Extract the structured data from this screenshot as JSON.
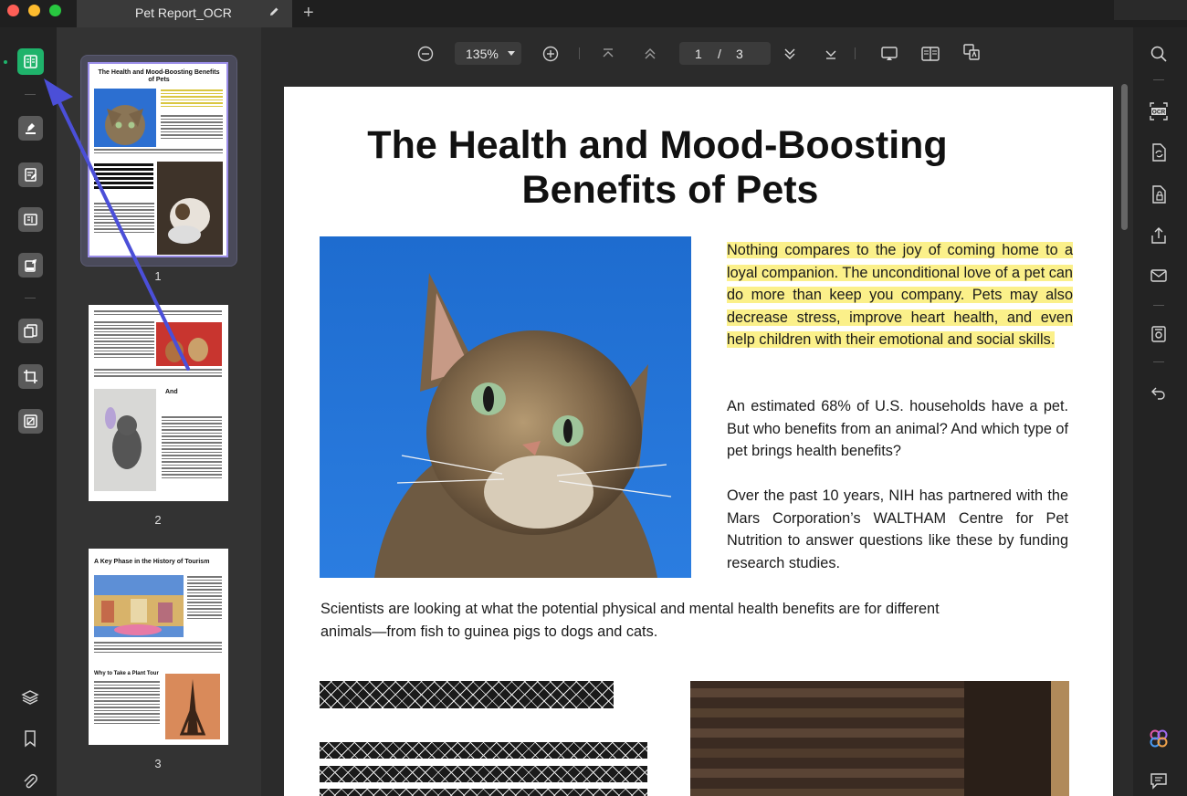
{
  "window": {
    "tab_title": "Pet Report_OCR",
    "edit_icon": "pencil-icon",
    "add_tab_label": "+"
  },
  "left_rail": {
    "items": [
      {
        "name": "reader-mode",
        "icon": "book-icon",
        "active": true
      },
      {
        "name": "comment",
        "icon": "highlighter-icon"
      },
      {
        "name": "edit-pdf",
        "icon": "edit-doc-icon"
      },
      {
        "name": "page-layout",
        "icon": "form-icon"
      },
      {
        "name": "sign",
        "icon": "signature-icon"
      },
      {
        "name": "organize",
        "icon": "pages-icon"
      },
      {
        "name": "crop",
        "icon": "crop-icon"
      },
      {
        "name": "protect",
        "icon": "compress-icon"
      }
    ],
    "bottom": [
      "layers-icon",
      "bookmark-icon",
      "attachment-icon"
    ]
  },
  "thumbnails": {
    "pages": [
      {
        "number": "1",
        "title": "The Health and Mood-Boosting Benefits of Pets"
      },
      {
        "number": "2",
        "title": "And"
      },
      {
        "number": "3",
        "title": "A Key Phase in the History of Tourism",
        "subhead": "Why to Take a Plant Tour"
      }
    ]
  },
  "toolbar": {
    "zoom": "135%",
    "current_page": "1",
    "page_separator": "/",
    "total_pages": "3"
  },
  "document": {
    "title_line1": "The Health and Mood-Boosting",
    "title_line2": "Benefits of Pets",
    "para1": "Nothing compares to the joy of coming home to a loyal companion. The unconditional love of a pet can do more than keep you company. Pets may also decrease stress, improve heart health, and even help children with their emotional and social skills.",
    "para2": "An estimated 68% of U.S. households have a pet. But who benefits from an animal? And which type of pet brings health benefits?",
    "para3": "Over the past 10 years, NIH has partnered with the Mars Corporation’s WALTHAM Centre for Pet Nutrition to answer questions like these by funding research studies.",
    "para4": "Scientists are looking at what the potential physical and mental health benefits are for different animals—from fish to guinea pigs to dogs and cats."
  },
  "right_rail": {
    "items": [
      "search-icon",
      "ocr-icon",
      "convert-icon",
      "protect-doc-icon",
      "share-icon",
      "mail-icon",
      "save-icon",
      "undo-icon"
    ],
    "bottom": [
      "ai-assistant-icon",
      "comment-icon"
    ],
    "ocr_label": "OCR"
  },
  "colors": {
    "accent_green": "#1fb36b",
    "highlight_yellow": "#fbf08a",
    "annotation_arrow": "#4b4fd8",
    "thumbnail_border": "#9b8ee9"
  }
}
